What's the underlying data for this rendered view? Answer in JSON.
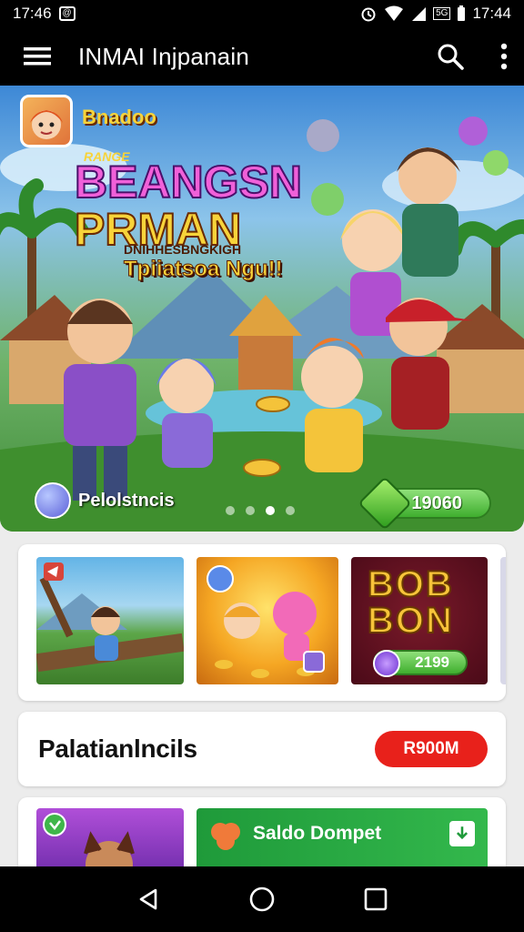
{
  "status_bar": {
    "time": "17:46",
    "notification_badge": "@",
    "network_label": "5G",
    "clock_right": "17:44"
  },
  "app_bar": {
    "title": "INMAI Injpanain"
  },
  "hero": {
    "brand": "Bnadoo",
    "pre_title": "RANGE",
    "title_line1": "BEANGSN",
    "title_line2": "PRMAN",
    "subtitle_line1": "DNIHHESBNGKIGH",
    "subtitle_line2": "Tpiiatsoa Ngu!!",
    "bottom_label": "Pelolstncis",
    "reward_value": "19060",
    "carousel_dots": 4,
    "active_dot": 2
  },
  "games_row": {
    "thumb3_word_line1": "BOB",
    "thumb3_word_line2": "BON",
    "thumb3_value": "2199"
  },
  "wallet": {
    "title": "Palatianlncils",
    "button_label": "R900M"
  },
  "bottom_row": {
    "dompet_label": "Saldo Dompet"
  },
  "colors": {
    "accent_red": "#e8211b",
    "reward_green": "#3fae2e",
    "dompet_green": "#1f9a3a"
  }
}
